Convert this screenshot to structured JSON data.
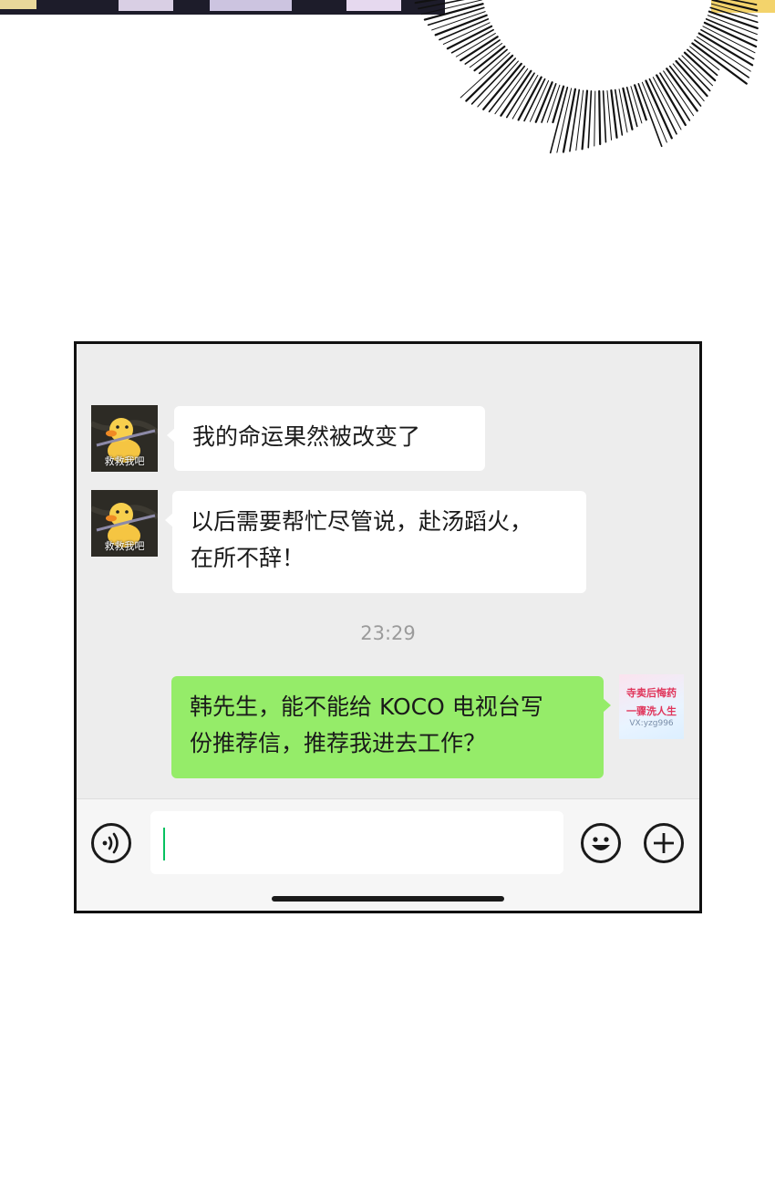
{
  "chat": {
    "messages": [
      {
        "sender": "contact",
        "avatar_caption": "救救我吧",
        "text": "我的命运果然被改变了"
      },
      {
        "sender": "contact",
        "avatar_caption": "救救我吧",
        "text_line1": "以后需要帮忙尽管说，赴汤蹈火，",
        "text_line2": "在所不辞！"
      },
      {
        "sender": "me",
        "text_line1": "韩先生，能不能给 KOCO 电视台写",
        "text_line2": "份推荐信，推荐我进去工作？"
      }
    ],
    "timestamp": "23:29",
    "my_avatar": {
      "line1": "寺卖后悔药",
      "line2": "一骤洗人生",
      "line3": "VX:yzg996"
    }
  },
  "input_bar": {
    "input_value": "",
    "voice_icon": "voice-icon",
    "emoji_icon": "emoji-icon",
    "plus_icon": "plus-icon"
  },
  "colors": {
    "chat_bg": "#ededed",
    "incoming_bubble": "#ffffff",
    "outgoing_bubble": "#95ec69",
    "caret": "#07c160"
  }
}
